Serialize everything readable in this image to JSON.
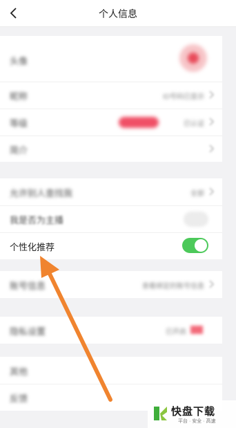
{
  "header": {
    "title": "个人信息",
    "back_icon": "chevron-left-icon"
  },
  "profile_rows": [
    {
      "label": "头像"
    },
    {
      "label": "昵称",
      "value": "ID号码已显示"
    },
    {
      "label": "等级",
      "value": "已认证"
    },
    {
      "label": "简介"
    }
  ],
  "settings_rows": [
    {
      "label": "允许别人查找我",
      "value": "全部"
    },
    {
      "label": "我是否为主播"
    },
    {
      "label": "个性化推荐",
      "toggle": true
    }
  ],
  "more_rows": [
    {
      "label": "账号信息",
      "value": "查看绑定的账号信息"
    },
    {
      "label": "隐私设置",
      "value": "已开启"
    }
  ],
  "bottom_rows": [
    {
      "label": "其他"
    },
    {
      "label": "反馈"
    }
  ],
  "watermark": {
    "brand": "快盘下载",
    "tagline": "平台 · 安全 · 高速"
  },
  "colors": {
    "toggle_on": "#4cc95a",
    "arrow": "#f0842f",
    "accent_red": "#f04f66"
  }
}
